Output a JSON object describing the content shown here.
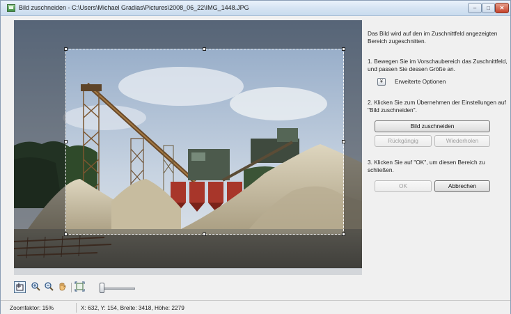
{
  "window": {
    "title": "Bild zuschneiden - C:\\Users\\Michael Gradias\\Pictures\\2008_06_22\\IMG_1448.JPG",
    "controls": {
      "minimize": "–",
      "maximize": "□",
      "close": "✕"
    }
  },
  "panel": {
    "intro": "Das Bild wird auf den im Zuschnittfeld angezeigten Bereich zugeschnitten.",
    "step1": "1. Bewegen Sie im Vorschaubereich das Zuschnittfeld, und passen Sie dessen Größe an.",
    "advanced_toggle": "¥",
    "advanced_label": "Erweiterte Optionen",
    "step2": "2. Klicken Sie zum Übernehmen der Einstellungen auf \"Bild zuschneiden\".",
    "crop_button": "Bild zuschneiden",
    "undo_button": "Rückgängig",
    "redo_button": "Wiederholen",
    "step3": "3. Klicken Sie auf \"OK\", um diesen Bereich zu schließen.",
    "ok_button": "OK",
    "cancel_button": "Abbrechen"
  },
  "toolbar": {
    "tools": [
      "crop-select-icon",
      "zoom-in-icon",
      "zoom-out-icon",
      "hand-pan-icon",
      "fit-to-window-icon",
      "zoom-slider"
    ]
  },
  "statusbar": {
    "zoom": "Zoomfaktor: 15%",
    "coords": "X: 632, Y: 154, Breite: 3418, Höhe: 2279"
  },
  "colors": {
    "sky": "#a9bdd6",
    "sand": "#cfc3a5",
    "crane_rust": "#8a5a2e",
    "tank_red": "#a8362a",
    "trees": "#2f4a2a"
  }
}
